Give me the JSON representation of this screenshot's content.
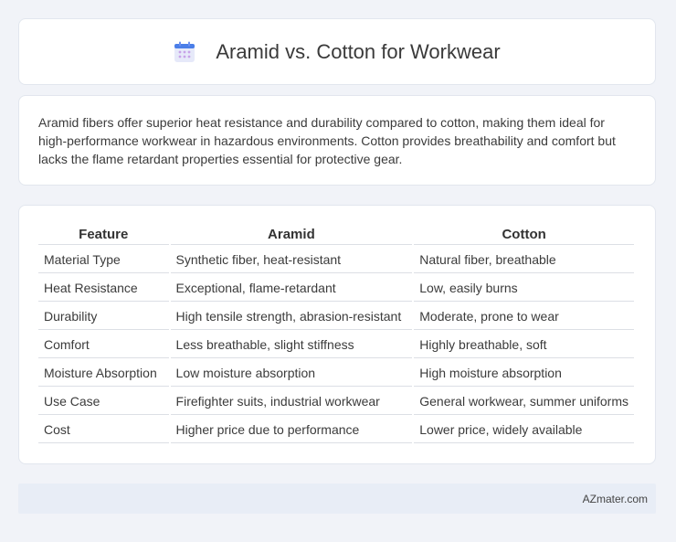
{
  "header": {
    "title": "Aramid vs. Cotton for Workwear",
    "icon": "calendar-icon"
  },
  "summary": {
    "text": "Aramid fibers offer superior heat resistance and durability compared to cotton, making them ideal for high-performance workwear in hazardous environments. Cotton provides breathability and comfort but lacks the flame retardant properties essential for protective gear."
  },
  "table": {
    "headers": [
      "Feature",
      "Aramid",
      "Cotton"
    ],
    "rows": [
      [
        "Material Type",
        "Synthetic fiber, heat-resistant",
        "Natural fiber, breathable"
      ],
      [
        "Heat Resistance",
        "Exceptional, flame-retardant",
        "Low, easily burns"
      ],
      [
        "Durability",
        "High tensile strength, abrasion-resistant",
        "Moderate, prone to wear"
      ],
      [
        "Comfort",
        "Less breathable, slight stiffness",
        "Highly breathable, soft"
      ],
      [
        "Moisture Absorption",
        "Low moisture absorption",
        "High moisture absorption"
      ],
      [
        "Use Case",
        "Firefighter suits, industrial workwear",
        "General workwear, summer uniforms"
      ],
      [
        "Cost",
        "Higher price due to performance",
        "Lower price, widely available"
      ]
    ]
  },
  "footer": {
    "site": "AZmater.com"
  },
  "colors": {
    "background": "#f1f3f8",
    "card": "#ffffff",
    "footer_bar": "#e8edf6",
    "icon_accent": "#4a7ee8",
    "icon_body": "#e4e8f8",
    "icon_dots": "#c9a0e6"
  }
}
